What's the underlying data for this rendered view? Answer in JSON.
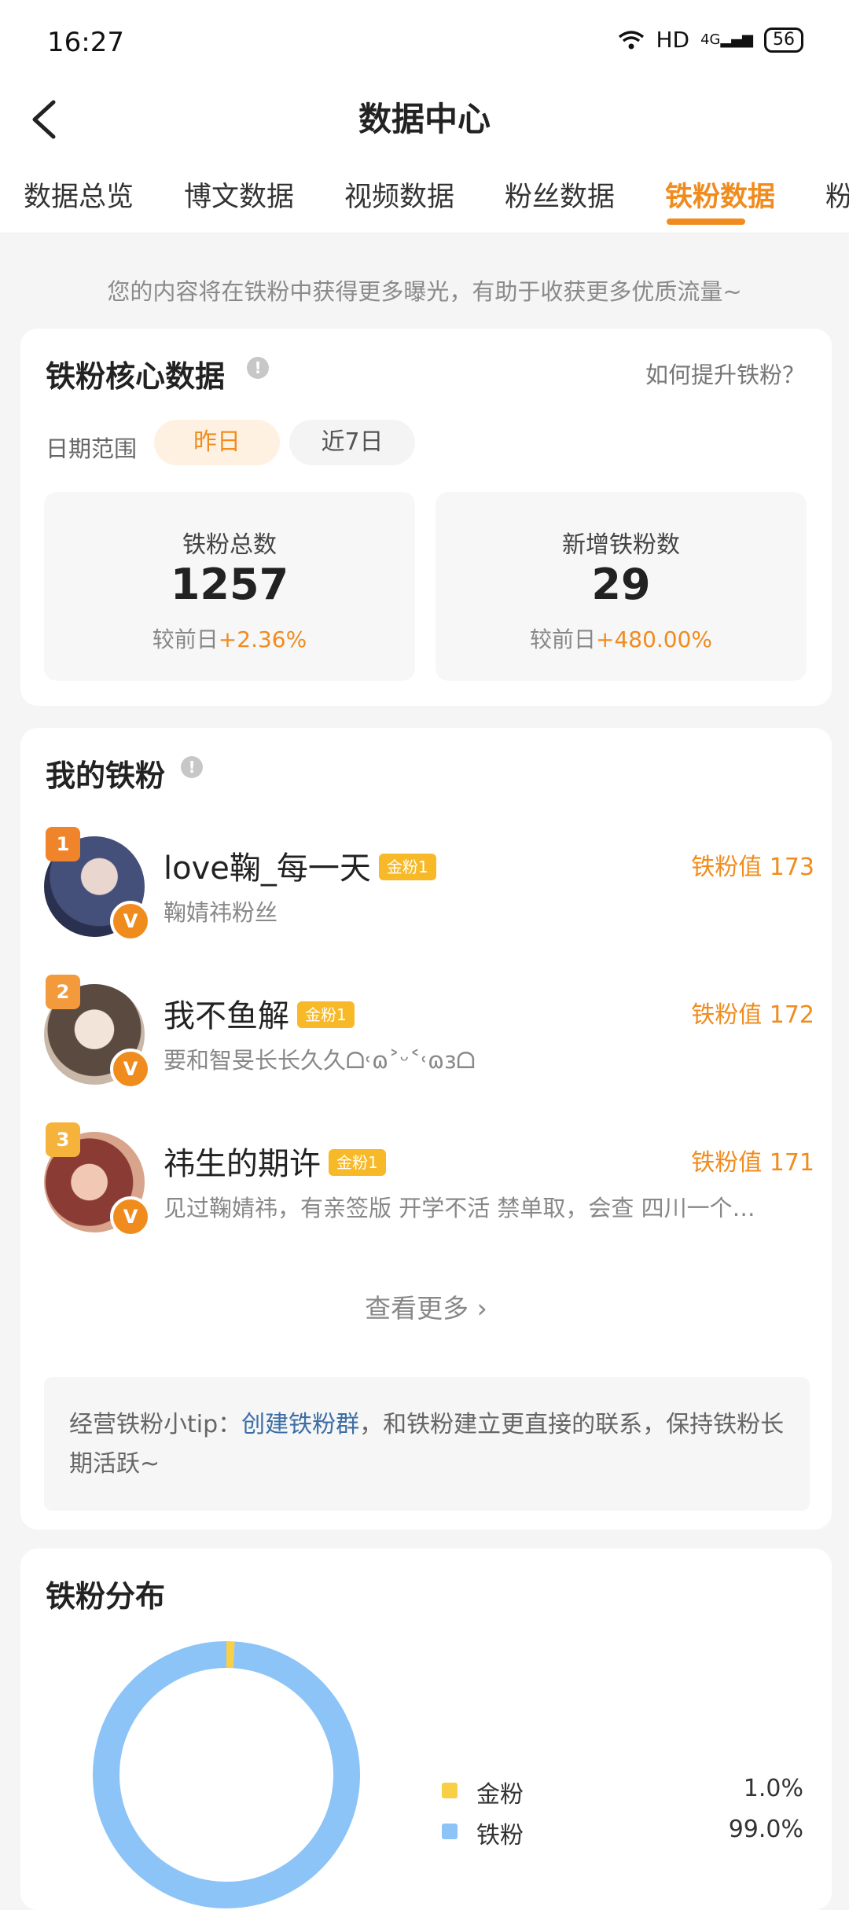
{
  "status_bar": {
    "time": "16:27",
    "network": "HD",
    "signal": "4G",
    "battery": "56"
  },
  "header": {
    "title": "数据中心"
  },
  "tabs": [
    "数据总览",
    "博文数据",
    "视频数据",
    "粉丝数据",
    "铁粉数据",
    "粉"
  ],
  "notice": "您的内容将在铁粉中获得更多曝光，有助于收获更多优质流量~",
  "core": {
    "title": "铁粉核心数据",
    "help_link": "如何提升铁粉？",
    "date_label": "日期范围",
    "date_options": [
      "昨日",
      "近7日"
    ],
    "stats": [
      {
        "label": "铁粉总数",
        "value": "1257",
        "compare_prefix": "较前日",
        "change": "+2.36%"
      },
      {
        "label": "新增铁粉数",
        "value": "29",
        "compare_prefix": "较前日",
        "change": "+480.00%"
      }
    ]
  },
  "my_fans": {
    "title": "我的铁粉",
    "items": [
      {
        "rank": "1",
        "name": "love鞠_每一天",
        "badge": "金粉1",
        "desc": "鞠婧祎粉丝",
        "score": "铁粉值 173",
        "v": "V"
      },
      {
        "rank": "2",
        "name": "我不鱼解",
        "badge": "金粉1",
        "desc": "要和智旻长长久久ᗝ˓ɷ˃ᵕ˂˓ɷɜᗝ",
        "score": "铁粉值 172",
        "v": "V"
      },
      {
        "rank": "3",
        "name": "祎生的期许",
        "badge": "金粉1",
        "desc": "见过鞠婧祎，有亲签版 开学不活 禁单取，会查 四川一个还…",
        "score": "铁粉值 171",
        "v": "V"
      }
    ],
    "more": "查看更多",
    "tip_prefix": "经营铁粉小tip：",
    "tip_link": "创建铁粉群",
    "tip_suffix": "，和铁粉建立更直接的联系，保持铁粉长期活跃~"
  },
  "distribution": {
    "title": "铁粉分布",
    "legend": [
      {
        "label": "金粉",
        "pct": "1.0%",
        "color": "#f9cf45"
      },
      {
        "label": "铁粉",
        "pct": "99.0%",
        "color": "#8cc4f8"
      }
    ]
  },
  "colors": {
    "accent": "#f08c1e",
    "link": "#3c6ea6",
    "gold": "#f9cf45",
    "iron": "#8cc4f8"
  },
  "chart_data": {
    "type": "pie",
    "title": "铁粉分布",
    "categories": [
      "金粉",
      "铁粉"
    ],
    "values": [
      1.0,
      99.0
    ]
  }
}
